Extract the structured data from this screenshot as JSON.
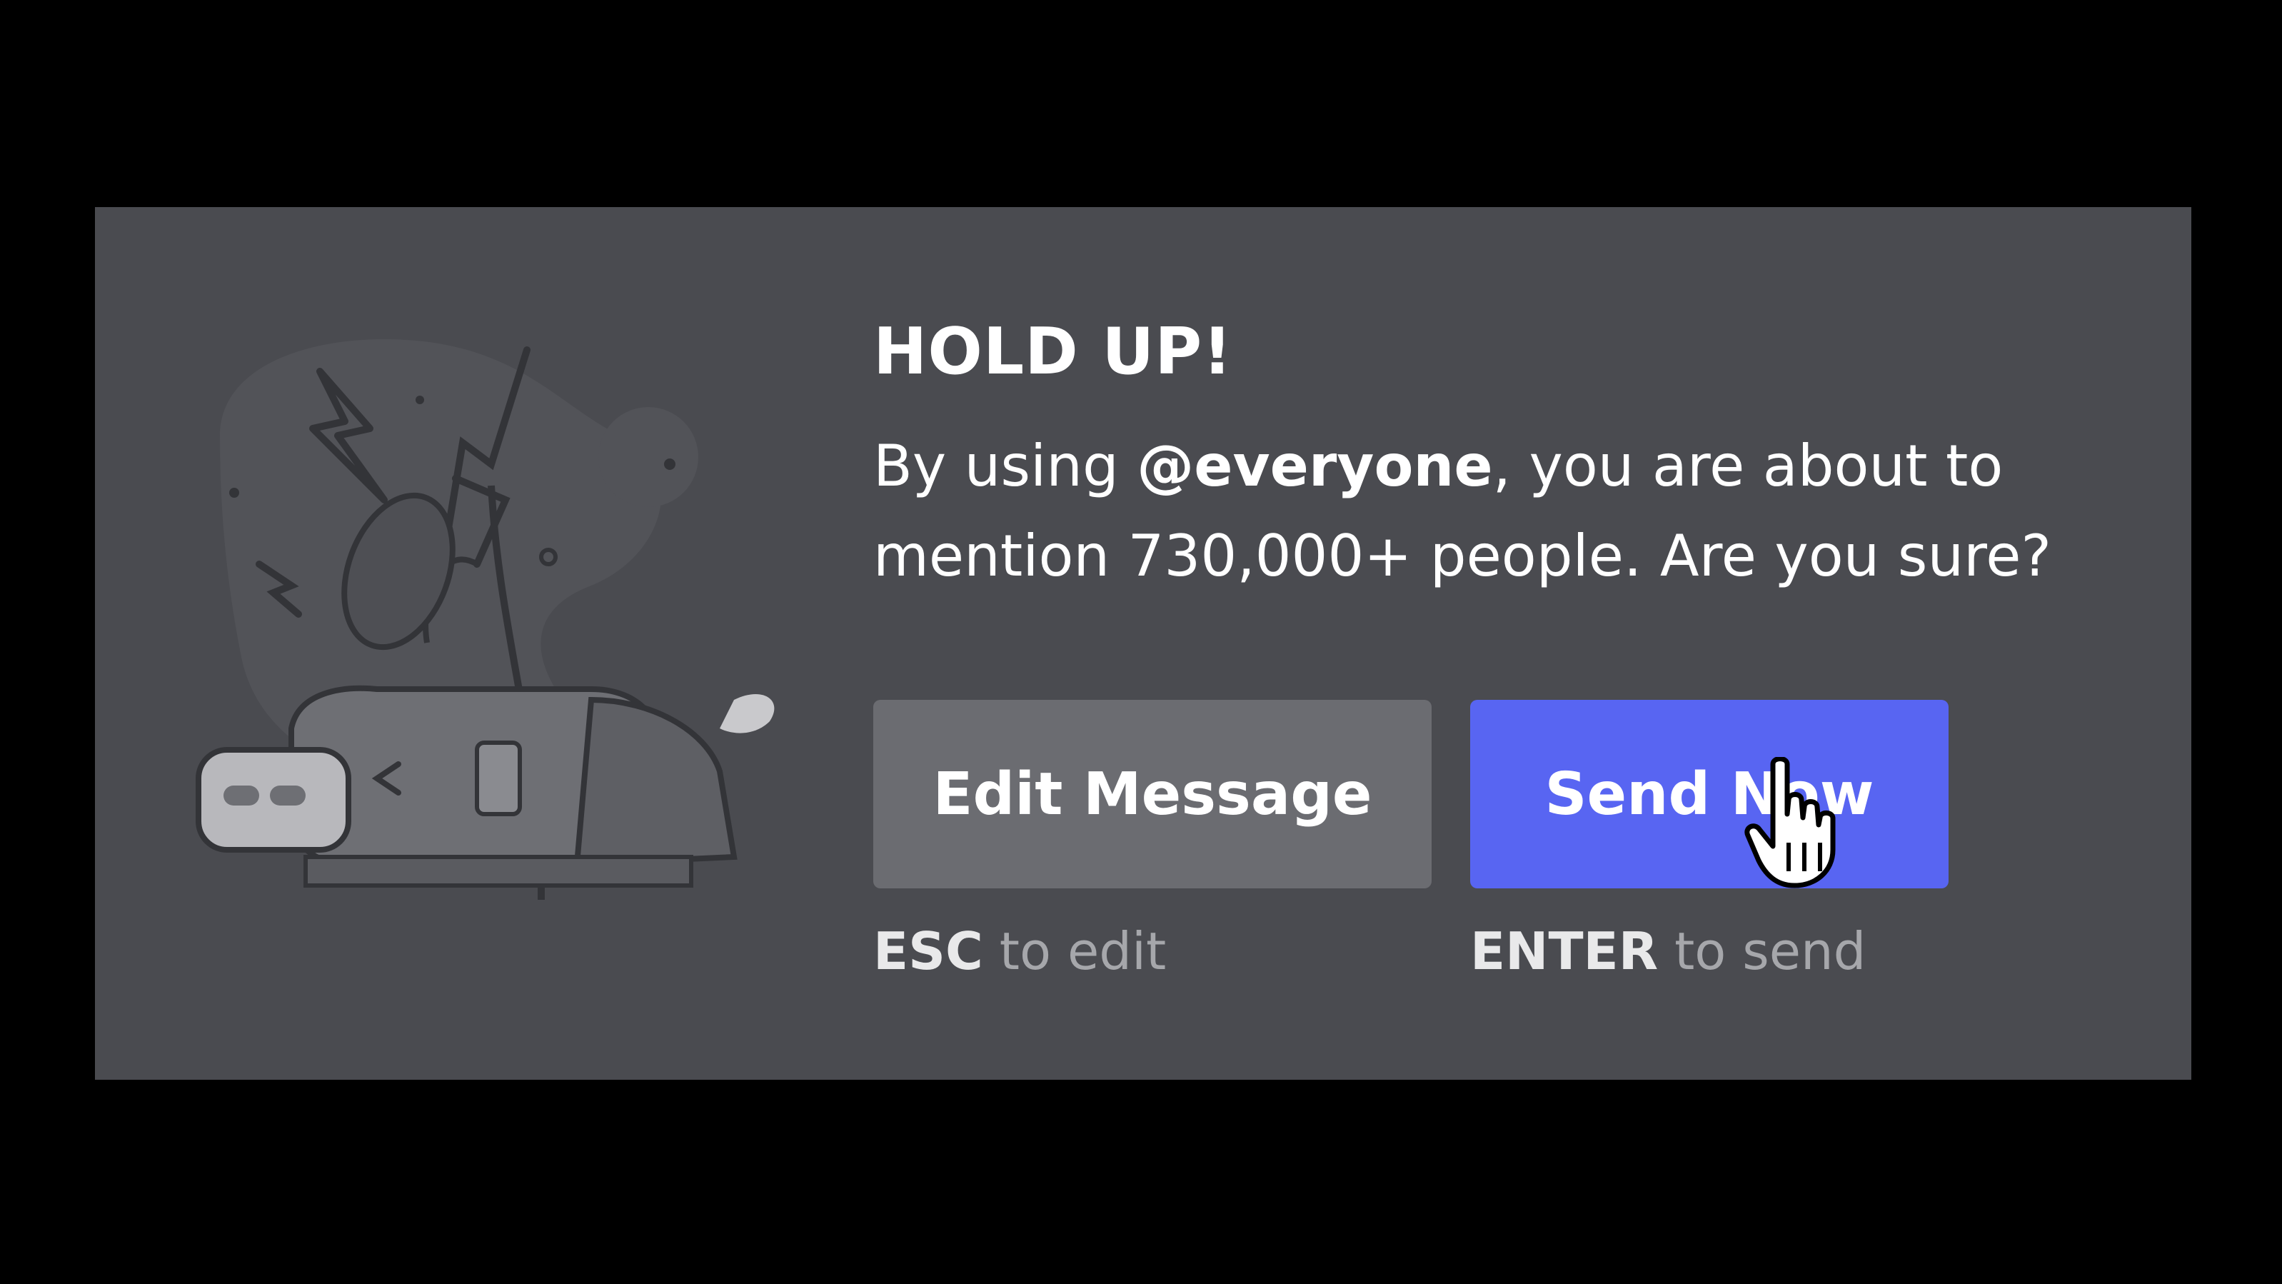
{
  "dialog": {
    "title": "HOLD UP!",
    "message_prefix": "By using ",
    "mention": "@everyone",
    "message_suffix": ", you are about to mention 730,000+ people. Are you sure?",
    "edit_button": "Edit Message",
    "send_button": "Send Now",
    "esc_key": "ESC",
    "esc_hint": " to edit",
    "enter_key": "ENTER",
    "enter_hint": " to send"
  },
  "colors": {
    "modal_bg": "#4a4b50",
    "edit_button_bg": "#6b6c71",
    "send_button_bg": "#5865f2",
    "hint_text": "#a6a7ab"
  },
  "icons": {
    "illustration": "sleeping-wumpus-illustration",
    "cursor": "hand-pointer-cursor-icon"
  }
}
